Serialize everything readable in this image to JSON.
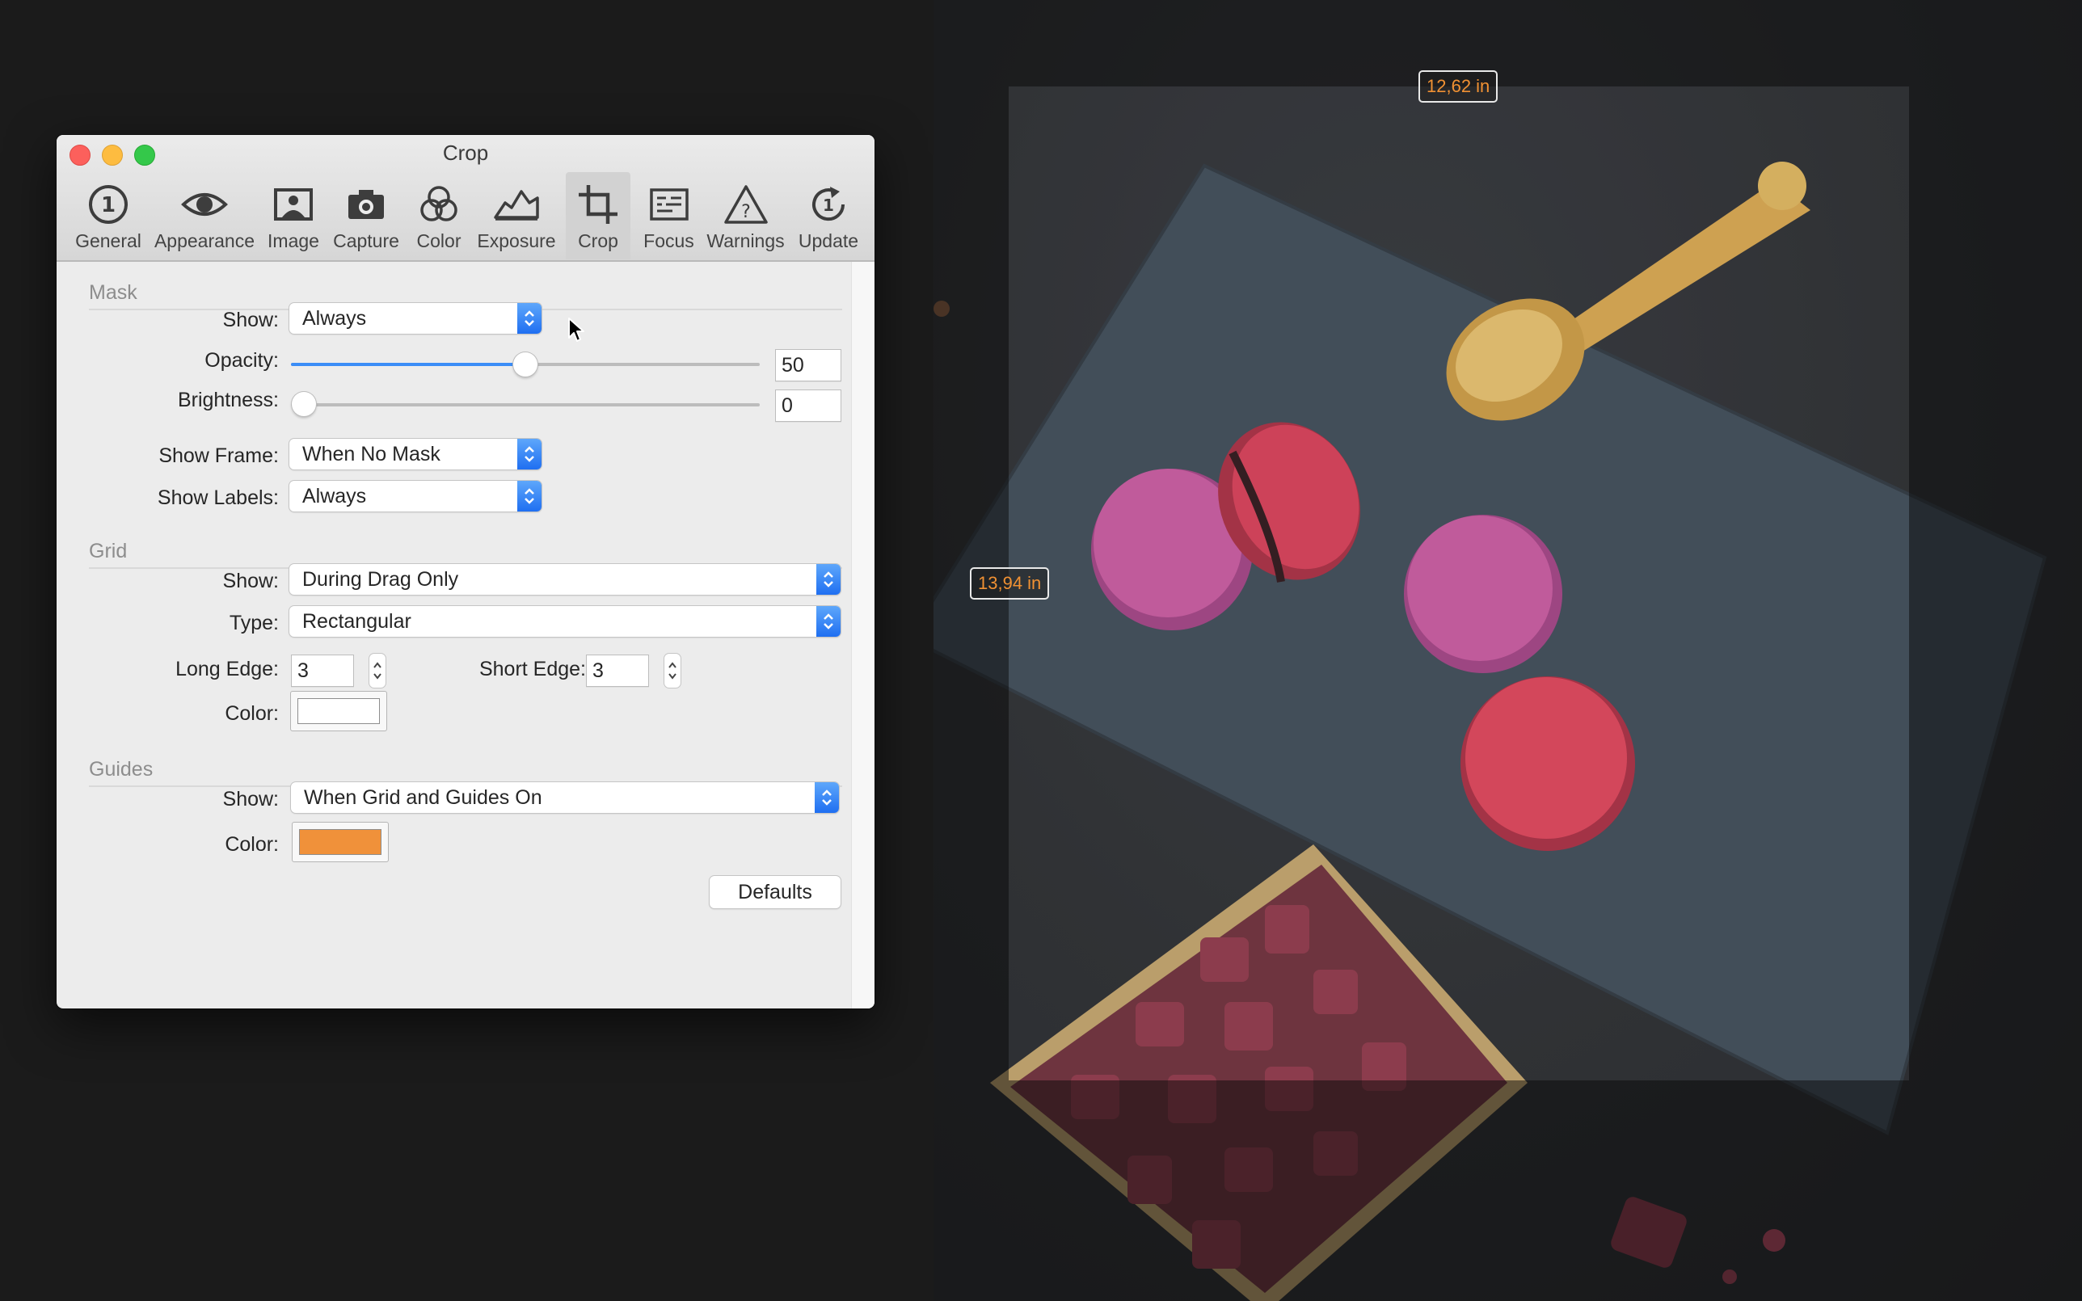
{
  "window": {
    "title": "Crop"
  },
  "toolbar": {
    "items": [
      {
        "label": "General",
        "icon": "general-icon"
      },
      {
        "label": "Appearance",
        "icon": "eye-icon"
      },
      {
        "label": "Image",
        "icon": "image-icon"
      },
      {
        "label": "Capture",
        "icon": "camera-icon"
      },
      {
        "label": "Color",
        "icon": "color-circles-icon"
      },
      {
        "label": "Exposure",
        "icon": "exposure-icon"
      },
      {
        "label": "Crop",
        "icon": "crop-icon",
        "selected": true
      },
      {
        "label": "Focus",
        "icon": "focus-icon"
      },
      {
        "label": "Warnings",
        "icon": "warning-icon"
      },
      {
        "label": "Update",
        "icon": "update-icon"
      }
    ]
  },
  "mask": {
    "header": "Mask",
    "show_label": "Show:",
    "show_value": "Always",
    "opacity_label": "Opacity:",
    "opacity_value": "50",
    "opacity_fraction": 0.5,
    "brightness_label": "Brightness:",
    "brightness_value": "0",
    "brightness_fraction": 0.0,
    "show_frame_label": "Show Frame:",
    "show_frame_value": "When No Mask",
    "show_labels_label": "Show Labels:",
    "show_labels_value": "Always"
  },
  "grid": {
    "header": "Grid",
    "show_label": "Show:",
    "show_value": "During Drag Only",
    "type_label": "Type:",
    "type_value": "Rectangular",
    "long_edge_label": "Long Edge:",
    "long_edge_value": "3",
    "short_edge_label": "Short Edge:",
    "short_edge_value": "3",
    "color_label": "Color:",
    "color": "#ffffff"
  },
  "guides": {
    "header": "Guides",
    "show_label": "Show:",
    "show_value": "When Grid and Guides On",
    "color_label": "Color:",
    "color": "#f0913a"
  },
  "buttons": {
    "defaults": "Defaults"
  },
  "crop_overlay": {
    "width_label": "12,62 in",
    "height_label": "13,94 in",
    "label_color": "#f09133"
  }
}
